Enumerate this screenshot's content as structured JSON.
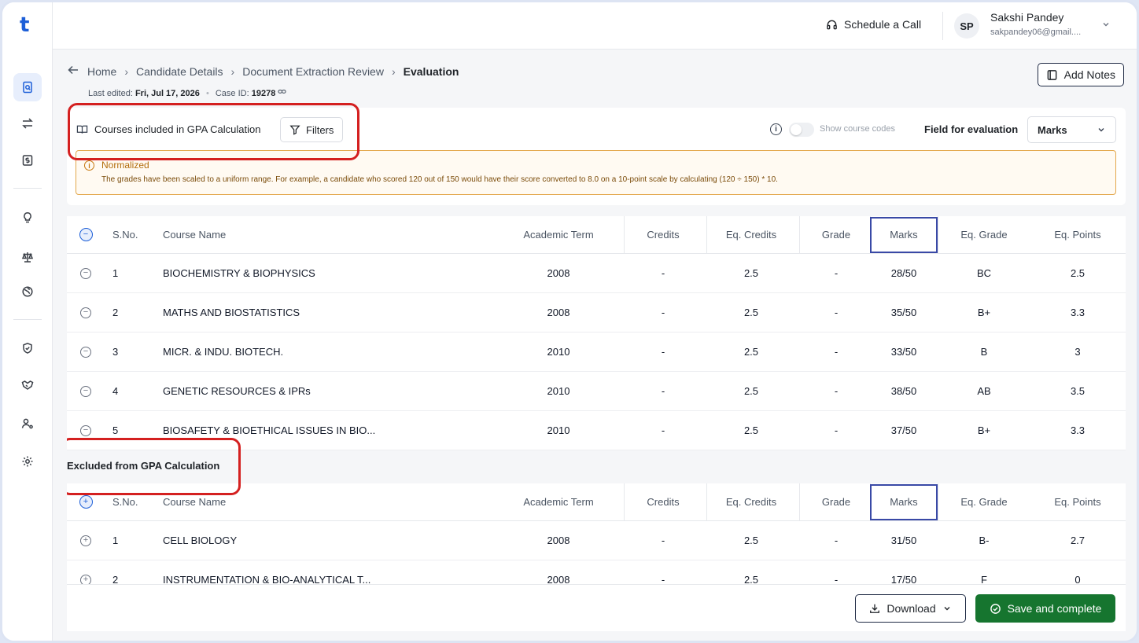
{
  "app": {
    "logo": "t"
  },
  "topbar": {
    "schedule_call": "Schedule a Call",
    "avatar_initials": "SP",
    "user_name": "Sakshi Pandey",
    "user_email": "sakpandey06@gmail...."
  },
  "breadcrumb": {
    "items": [
      "Home",
      "Candidate Details",
      "Document Extraction Review"
    ],
    "current": "Evaluation"
  },
  "meta": {
    "last_edited_label": "Last edited:",
    "last_edited_value": "Fri, Jul 17, 2026",
    "case_label": "Case ID:",
    "case_value": "19278"
  },
  "add_notes_label": "Add Notes",
  "courses_header": {
    "title": "Courses included in GPA Calculation",
    "filters_label": "Filters",
    "show_codes_label": "Show course codes",
    "field_label": "Field for evaluation",
    "field_value": "Marks"
  },
  "notice": {
    "title": "Normalized",
    "text": "The grades have been scaled to a uniform range. For example, a candidate who scored 120 out of 150 would have their score converted to 8.0 on a 10-point scale by calculating (120 ÷ 150) * 10."
  },
  "columns": {
    "sno": "S.No.",
    "name": "Course Name",
    "term": "Academic Term",
    "credits": "Credits",
    "eq_credits": "Eq. Credits",
    "grade": "Grade",
    "marks": "Marks",
    "eq_grade": "Eq. Grade",
    "eq_points": "Eq. Points"
  },
  "included": [
    {
      "sno": "1",
      "name": "BIOCHEMISTRY & BIOPHYSICS",
      "term": "2008",
      "credits": "-",
      "eq_credits": "2.5",
      "grade": "-",
      "marks": "28/50",
      "eq_grade": "BC",
      "eq_points": "2.5"
    },
    {
      "sno": "2",
      "name": "MATHS AND BIOSTATISTICS",
      "term": "2008",
      "credits": "-",
      "eq_credits": "2.5",
      "grade": "-",
      "marks": "35/50",
      "eq_grade": "B+",
      "eq_points": "3.3"
    },
    {
      "sno": "3",
      "name": "MICR. & INDU. BIOTECH.",
      "term": "2010",
      "credits": "-",
      "eq_credits": "2.5",
      "grade": "-",
      "marks": "33/50",
      "eq_grade": "B",
      "eq_points": "3"
    },
    {
      "sno": "4",
      "name": "GENETIC RESOURCES & IPRs",
      "term": "2010",
      "credits": "-",
      "eq_credits": "2.5",
      "grade": "-",
      "marks": "38/50",
      "eq_grade": "AB",
      "eq_points": "3.5"
    },
    {
      "sno": "5",
      "name": "BIOSAFETY & BIOETHICAL ISSUES IN BIO...",
      "term": "2010",
      "credits": "-",
      "eq_credits": "2.5",
      "grade": "-",
      "marks": "37/50",
      "eq_grade": "B+",
      "eq_points": "3.3"
    }
  ],
  "excluded_title": "Excluded from GPA Calculation",
  "excluded": [
    {
      "sno": "1",
      "name": "CELL BIOLOGY",
      "term": "2008",
      "credits": "-",
      "eq_credits": "2.5",
      "grade": "-",
      "marks": "31/50",
      "eq_grade": "B-",
      "eq_points": "2.7"
    },
    {
      "sno": "2",
      "name": "INSTRUMENTATION & BIO-ANALYTICAL T...",
      "term": "2008",
      "credits": "-",
      "eq_credits": "2.5",
      "grade": "-",
      "marks": "17/50",
      "eq_grade": "F",
      "eq_points": "0"
    }
  ],
  "footer": {
    "download_label": "Download",
    "save_label": "Save and complete"
  },
  "colors": {
    "accent": "#1d5fd8",
    "save_green": "#16752f",
    "highlight_red": "#d42020",
    "notice_orange": "#e3a74b"
  }
}
